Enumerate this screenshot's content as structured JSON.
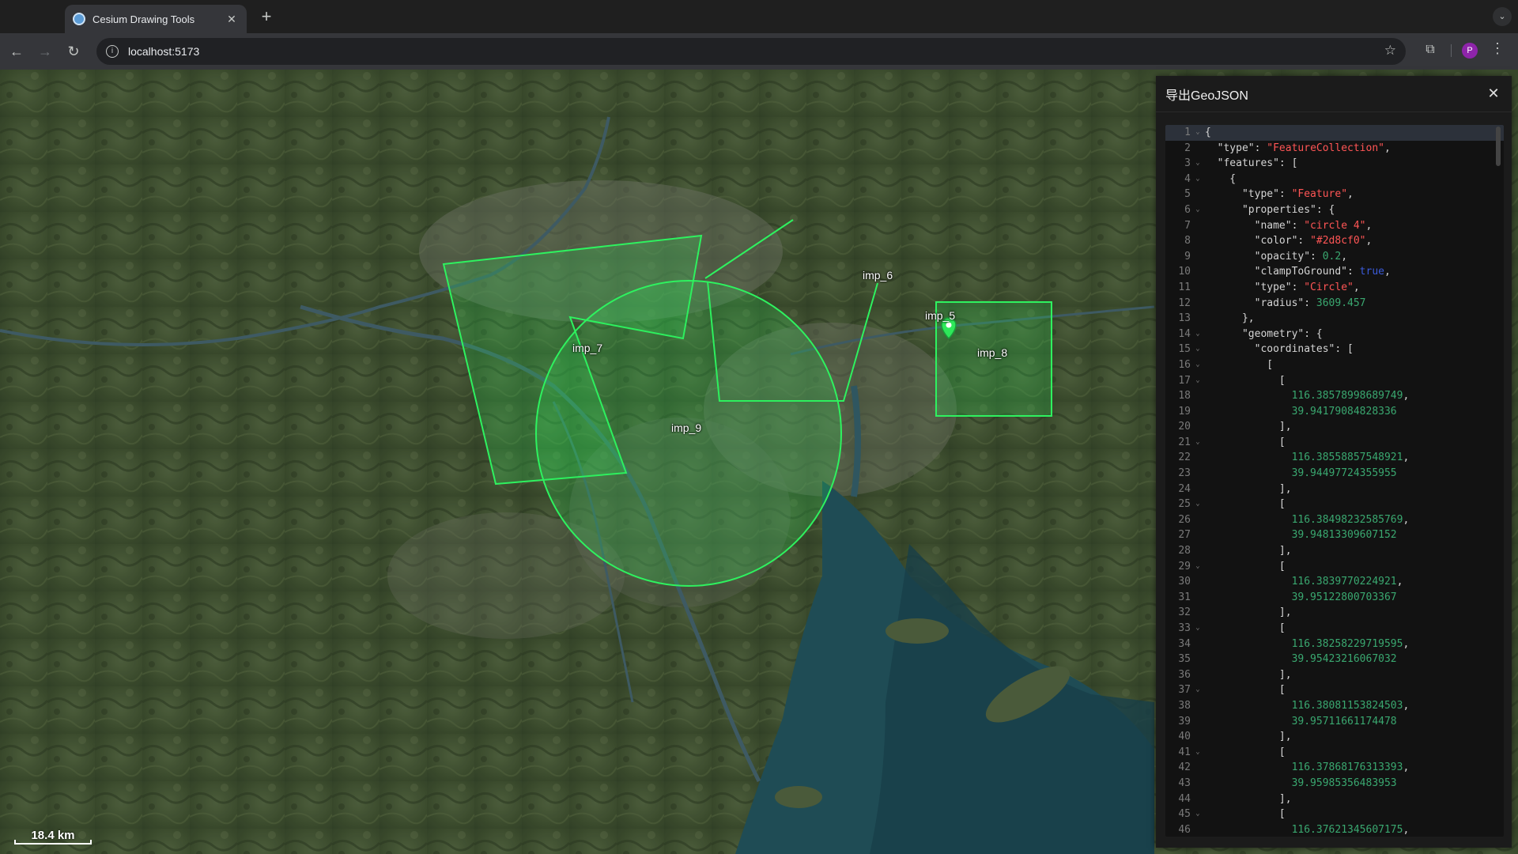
{
  "browser": {
    "tab_title": "Cesium Drawing Tools",
    "url": "localhost:5173",
    "avatar_letter": "P"
  },
  "map": {
    "labels": [
      {
        "id": "imp_6",
        "text": "imp_6"
      },
      {
        "id": "imp_5",
        "text": "imp_5"
      },
      {
        "id": "imp_8",
        "text": "imp_8"
      },
      {
        "id": "imp_7",
        "text": "imp_7"
      },
      {
        "id": "imp_9",
        "text": "imp_9"
      }
    ],
    "scale_text": "18.4 km",
    "drawing_color": "#2d8cf0"
  },
  "panel": {
    "title": "导出GeoJSON",
    "lines": [
      {
        "num": "1",
        "fold": true,
        "text": "{"
      },
      {
        "num": "2",
        "fold": false,
        "text": "  \"type\": \"FeatureCollection\","
      },
      {
        "num": "3",
        "fold": true,
        "text": "  \"features\": ["
      },
      {
        "num": "4",
        "fold": true,
        "text": "    {"
      },
      {
        "num": "5",
        "fold": false,
        "text": "      \"type\": \"Feature\","
      },
      {
        "num": "6",
        "fold": true,
        "text": "      \"properties\": {"
      },
      {
        "num": "7",
        "fold": false,
        "text": "        \"name\": \"circle 4\","
      },
      {
        "num": "8",
        "fold": false,
        "text": "        \"color\": \"#2d8cf0\","
      },
      {
        "num": "9",
        "fold": false,
        "text": "        \"opacity\": 0.2,"
      },
      {
        "num": "10",
        "fold": false,
        "text": "        \"clampToGround\": true,"
      },
      {
        "num": "11",
        "fold": false,
        "text": "        \"type\": \"Circle\","
      },
      {
        "num": "12",
        "fold": false,
        "text": "        \"radius\": 3609.457"
      },
      {
        "num": "13",
        "fold": false,
        "text": "      },"
      },
      {
        "num": "14",
        "fold": true,
        "text": "      \"geometry\": {"
      },
      {
        "num": "15",
        "fold": true,
        "text": "        \"coordinates\": ["
      },
      {
        "num": "16",
        "fold": true,
        "text": "          ["
      },
      {
        "num": "17",
        "fold": true,
        "text": "            ["
      },
      {
        "num": "18",
        "fold": false,
        "text": "              116.38578998689749,"
      },
      {
        "num": "19",
        "fold": false,
        "text": "              39.94179084828336"
      },
      {
        "num": "20",
        "fold": false,
        "text": "            ],"
      },
      {
        "num": "21",
        "fold": true,
        "text": "            ["
      },
      {
        "num": "22",
        "fold": false,
        "text": "              116.38558857548921,"
      },
      {
        "num": "23",
        "fold": false,
        "text": "              39.94497724355955"
      },
      {
        "num": "24",
        "fold": false,
        "text": "            ],"
      },
      {
        "num": "25",
        "fold": true,
        "text": "            ["
      },
      {
        "num": "26",
        "fold": false,
        "text": "              116.38498232585769,"
      },
      {
        "num": "27",
        "fold": false,
        "text": "              39.94813309607152"
      },
      {
        "num": "28",
        "fold": false,
        "text": "            ],"
      },
      {
        "num": "29",
        "fold": true,
        "text": "            ["
      },
      {
        "num": "30",
        "fold": false,
        "text": "              116.3839770224921,"
      },
      {
        "num": "31",
        "fold": false,
        "text": "              39.95122800703367"
      },
      {
        "num": "32",
        "fold": false,
        "text": "            ],"
      },
      {
        "num": "33",
        "fold": true,
        "text": "            ["
      },
      {
        "num": "34",
        "fold": false,
        "text": "              116.38258229719595,"
      },
      {
        "num": "35",
        "fold": false,
        "text": "              39.95423216067032"
      },
      {
        "num": "36",
        "fold": false,
        "text": "            ],"
      },
      {
        "num": "37",
        "fold": true,
        "text": "            ["
      },
      {
        "num": "38",
        "fold": false,
        "text": "              116.38081153824503,"
      },
      {
        "num": "39",
        "fold": false,
        "text": "              39.95711661174478"
      },
      {
        "num": "40",
        "fold": false,
        "text": "            ],"
      },
      {
        "num": "41",
        "fold": true,
        "text": "            ["
      },
      {
        "num": "42",
        "fold": false,
        "text": "              116.37868176313393,"
      },
      {
        "num": "43",
        "fold": false,
        "text": "              39.95985356483953"
      },
      {
        "num": "44",
        "fold": false,
        "text": "            ],"
      },
      {
        "num": "45",
        "fold": true,
        "text": "            ["
      },
      {
        "num": "46",
        "fold": false,
        "text": "              116.37621345607175,"
      }
    ]
  }
}
